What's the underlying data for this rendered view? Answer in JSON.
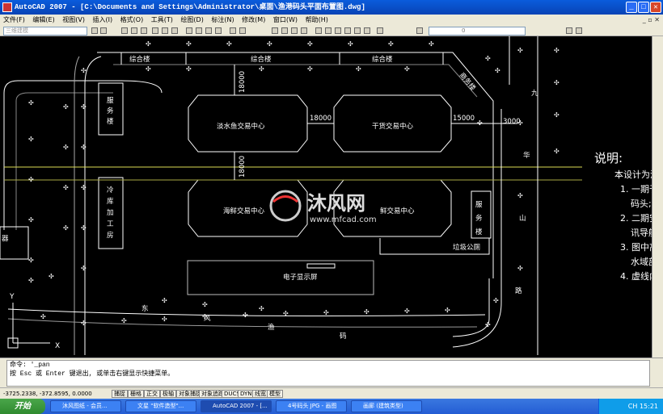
{
  "window": {
    "title": "AutoCAD 2007 - [C:\\Documents and Settings\\Administrator\\桌面\\渔港码头平面布置图.dwg]"
  },
  "menu": [
    "文件(F)",
    "编辑(E)",
    "视图(V)",
    "插入(I)",
    "格式(O)",
    "工具(T)",
    "绘图(D)",
    "标注(N)",
    "修改(M)",
    "窗口(W)",
    "帮助(H)"
  ],
  "toolbar": {
    "workspace": "三维建模",
    "layer": "0"
  },
  "drawing": {
    "bldg_zonghe_1": "综合楼",
    "bldg_zonghe_2": "综合楼",
    "bldg_zonghe_3": "综合楼",
    "fuwu_left": [
      "服",
      "务",
      "楼"
    ],
    "lengku": [
      "冷",
      "库",
      "加",
      "工",
      "房"
    ],
    "danshui": "淡水鱼交易中心",
    "gan": "干货交易中心",
    "haixian": "海鲜交易中心",
    "right_center": "鲜交易中心",
    "dim_18000_v1": "18000",
    "dim_18000_h": "18000",
    "dim_15000": "15000",
    "dim_3000": "3000",
    "dim_18000_v2": "18000",
    "shangwu": "商务楼",
    "fuwu_right": [
      "服",
      "务",
      "楼"
    ],
    "laji": "垃圾公厕",
    "screen": "电子显示屏",
    "road_right": [
      "九",
      "华",
      "山",
      "路"
    ],
    "road_bottom": [
      "东",
      "风",
      "渔",
      "码"
    ],
    "left_cut": "器",
    "notes_title": "说明:",
    "notes": [
      "本设计为渔",
      "1. 一期于",
      "码头;",
      "2. 二期安",
      "讯导航",
      "3. 图中高",
      "水域部",
      "4. 虚线内"
    ],
    "watermark_cn": "沐风网",
    "watermark_url": "www.mfcad.com",
    "ucs_y": "Y",
    "ucs_x": "X"
  },
  "command": {
    "line1": "命令: '_pan",
    "line2": "按 Esc 或 Enter 键退出, 或单击右键显示快捷菜单。"
  },
  "status": {
    "coords": "-3725.2338, -372.8595, 0.0000",
    "buttons": [
      "捕捉",
      "栅格",
      "正交",
      "极轴",
      "对象捕捉",
      "对象追踪",
      "DUCS",
      "DYN",
      "线宽",
      "模型"
    ]
  },
  "taskbar": {
    "start": "开始",
    "tasks": [
      "沐风图纸 - 会员...",
      "文星 \"软件造型\"...",
      "AutoCAD 2007 - [...",
      "4号码头 JPG - 画图",
      "画廊 (建筑类型)"
    ],
    "clock": "15:21",
    "lang": "CH"
  }
}
